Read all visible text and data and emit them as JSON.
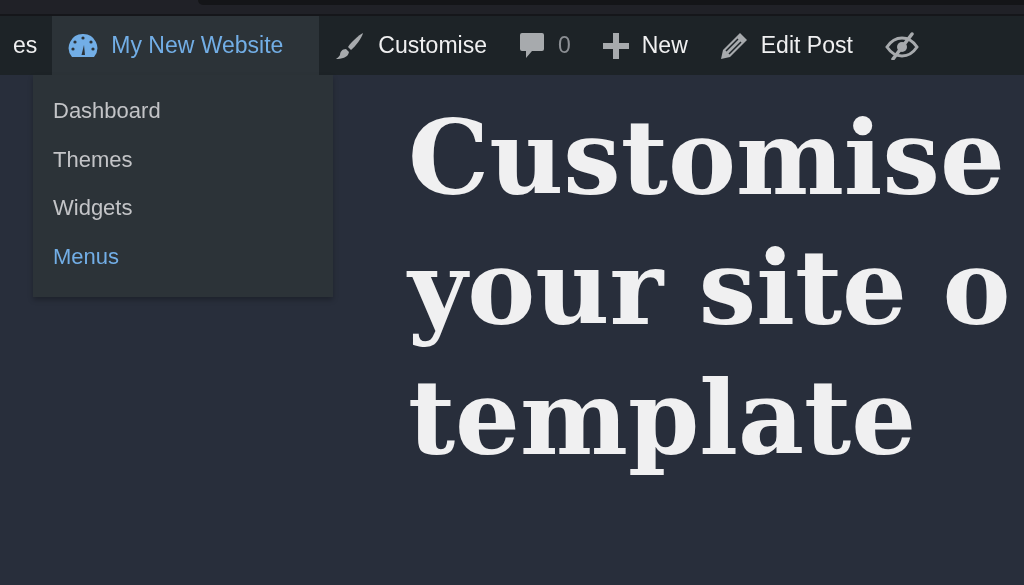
{
  "admin_bar": {
    "items": [
      {
        "kind": "text",
        "label": "es",
        "selected": false
      },
      {
        "kind": "dashboard",
        "label": "My New Website",
        "selected": true
      },
      {
        "kind": "brush",
        "label": "Customise",
        "selected": false
      },
      {
        "kind": "comment",
        "label": "0",
        "selected": false
      },
      {
        "kind": "plus",
        "label": "New",
        "selected": false
      },
      {
        "kind": "pencil",
        "label": "Edit Post",
        "selected": false
      },
      {
        "kind": "hidden",
        "selected": false
      }
    ]
  },
  "dropdown": {
    "items": [
      {
        "label": "Dashboard",
        "selected": false
      },
      {
        "label": "Themes",
        "selected": false
      },
      {
        "label": "Widgets",
        "selected": false
      },
      {
        "label": "Menus",
        "selected": true
      }
    ]
  },
  "heading": {
    "lines": [
      "Customise",
      "your site o",
      "template"
    ]
  }
}
